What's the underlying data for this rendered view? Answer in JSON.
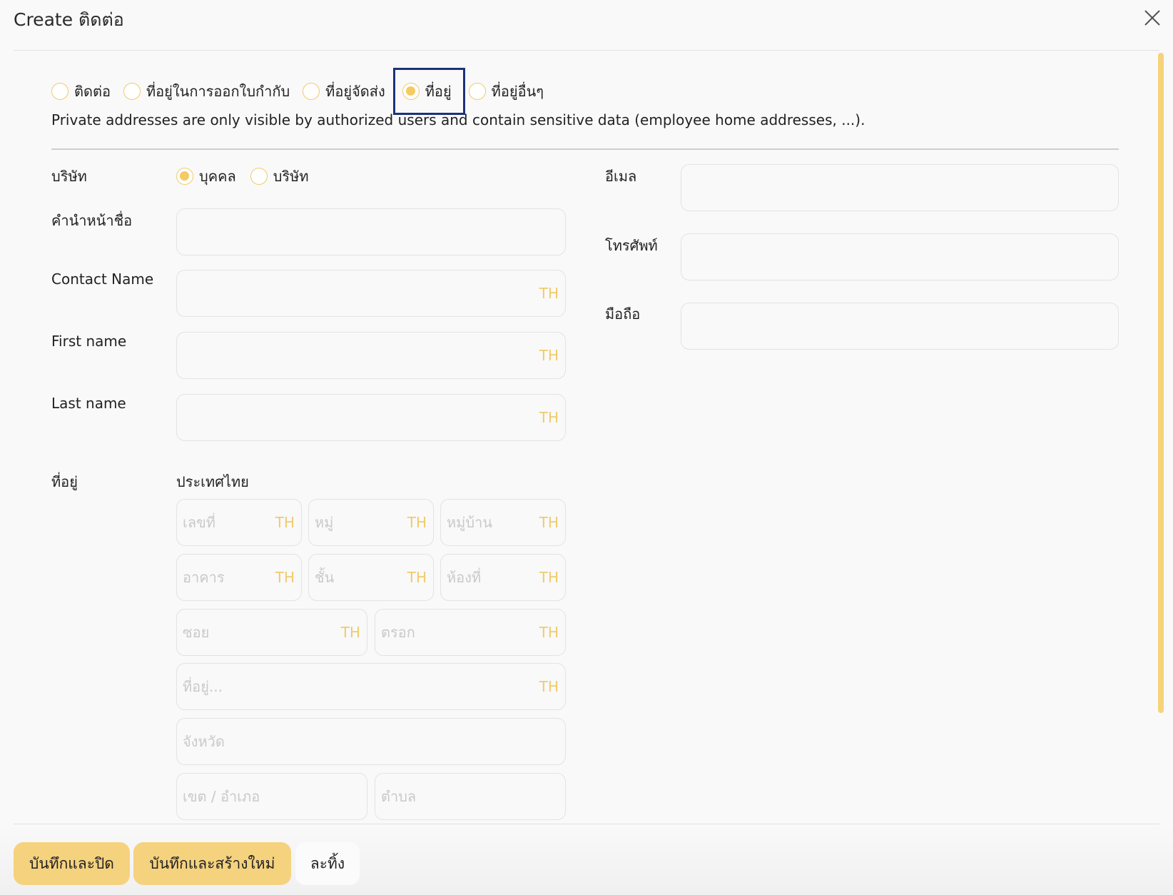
{
  "dialog": {
    "title": "Create ติดต่อ"
  },
  "address_types": [
    {
      "label": "ติดต่อ",
      "selected": false
    },
    {
      "label": "ที่อยู่ในการออกใบกำกับ",
      "selected": false
    },
    {
      "label": "ที่อยู่จัดส่ง",
      "selected": false
    },
    {
      "label": "ที่อยู่",
      "selected": true
    },
    {
      "label": "ที่อยู่อื่นๆ",
      "selected": false
    }
  ],
  "private_note": "Private addresses are only visible by authorized users and contain sensitive data (employee home addresses, ...).",
  "form": {
    "company_type": {
      "label": "บริษัท",
      "options": [
        {
          "label": "บุคคล",
          "selected": true
        },
        {
          "label": "บริษัท",
          "selected": false
        }
      ]
    },
    "title_label": "คำนำหน้าชื่อ",
    "contact_name_label": "Contact Name",
    "first_name_label": "First name",
    "last_name_label": "Last name",
    "address_label": "ที่อยู่",
    "country": "ประเทศไทย",
    "email_label": "อีเมล",
    "phone_label": "โทรศัพท์",
    "mobile_label": "มือถือ",
    "lang_tag": "TH"
  },
  "address_fields": {
    "house_no": "เลขที่",
    "moo": "หมู่",
    "village": "หมู่บ้าน",
    "building": "อาคาร",
    "floor": "ชั้น",
    "room": "ห้องที่",
    "soi": "ซอย",
    "trok": "ตรอก",
    "street": "ที่อยู่...",
    "province": "จังหวัด",
    "district": "เขต / อำเภอ",
    "subdistrict": "ตำบล"
  },
  "footer": {
    "save_close": "บันทึกและปิด",
    "save_new": "บันทึกและสร้างใหม่",
    "discard": "ละทิ้ง"
  },
  "colors": {
    "accent": "#f5d27e",
    "radio": "#f0cb6c",
    "focus": "#1d3378"
  }
}
